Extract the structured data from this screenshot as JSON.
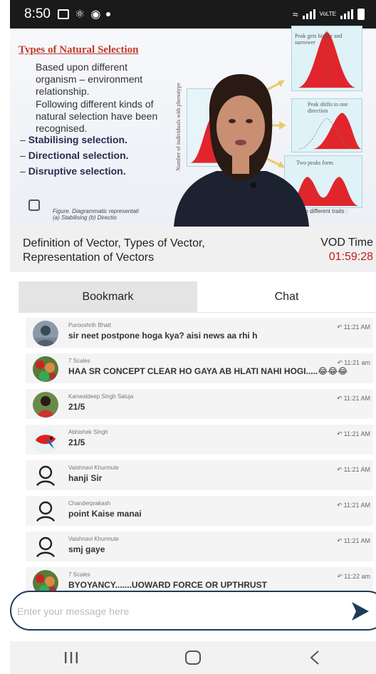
{
  "status_bar": {
    "time": "8:50"
  },
  "video": {
    "slide_title": "Types of Natural Selection",
    "paragraphs": [
      "Based upon different organism – environment relationship.",
      "Following different kinds of natural selection have been recognised."
    ],
    "bullets": [
      "Stabilising selection.",
      "Directional selection.",
      "Disruptive selection."
    ],
    "figure_caption": "Figure.  Diagrammatic representati",
    "figure_caption_2": "(a) Stabilising (b) Directio",
    "figure_right": "on different traits :",
    "graph_labels": {
      "peak_higher": "Peak gets higher and narrower",
      "peak_shifts": "Peak shifts to one direction",
      "two_peaks": "Two peaks form",
      "axis_y": "Number of individuals with phenotype"
    }
  },
  "lecture": {
    "title": "Definition of Vector, Types of Vector, Representation of Vectors",
    "vod_label": "VOD Time",
    "vod_time": "01:59:28"
  },
  "tabs": {
    "bookmark": "Bookmark",
    "chat": "Chat"
  },
  "chat": {
    "messages": [
      {
        "name": "Purooshrth Bhatt",
        "text": "sir neet postpone hoga kya? aisi news aa rhi h",
        "time": "11:21 AM"
      },
      {
        "name": "7 Scales",
        "text": "HAA SR CONCEPT CLEAR HO GAYA AB HLATI NAHI HOGI.....😂😂😂",
        "time": "11:21 am"
      },
      {
        "name": "Kanwaldeep Singh Saluja",
        "text": "21/5",
        "time": "11:21 AM"
      },
      {
        "name": "Abhishek Singh",
        "text": "21/5",
        "time": "11:21 AM"
      },
      {
        "name": "Vaishnavi Khurmute",
        "text": "hanji Sir",
        "time": "11:21 AM"
      },
      {
        "name": "Chanderprakash",
        "text": "point Kaise manai",
        "time": "11:21 AM"
      },
      {
        "name": "Vaishnavi Khurmute",
        "text": "smj gaye",
        "time": "11:21 AM"
      },
      {
        "name": "7 Scales",
        "text": "BYOYANCY.......UOWARD FORCE OR UPTHRUST",
        "time": "11:22 am"
      }
    ],
    "input_placeholder": "Enter your message here"
  },
  "colors": {
    "accent": "#1f3b5c",
    "vod_time": "#c61a1a",
    "slide_title": "#c0392b"
  }
}
